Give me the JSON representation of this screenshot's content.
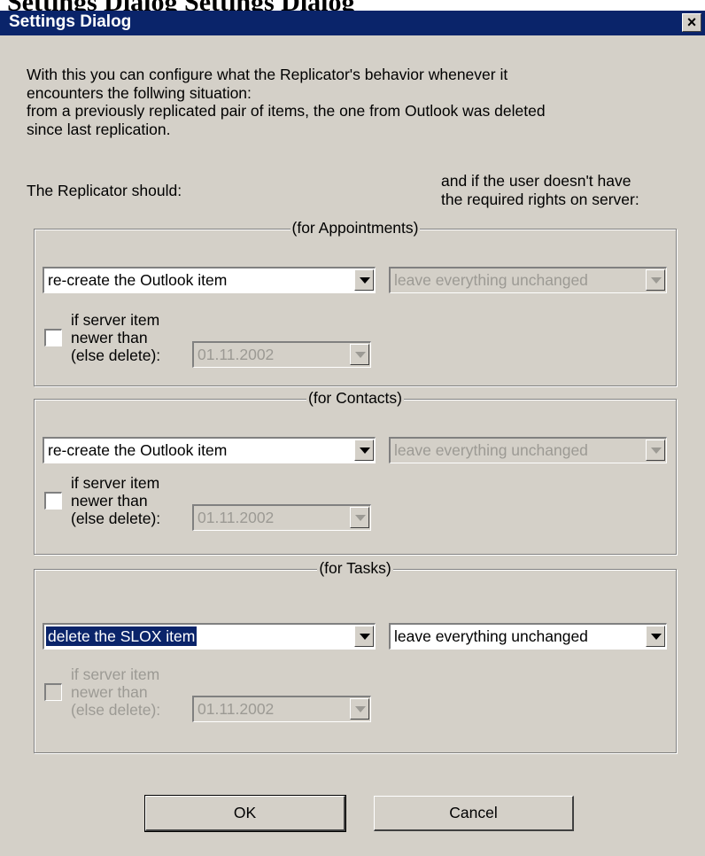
{
  "outer_title": "Settings Dialog Settings Dialog",
  "window": {
    "title": "Settings Dialog",
    "close_symbol": "×"
  },
  "intro": [
    "With this you can configure what the Replicator's behavior whenever it",
    "encounters the follwing situation:",
    "from a previously replicated pair of items, the one from Outlook was deleted",
    "since last replication."
  ],
  "replicator_label": "The Replicator should:",
  "rights_label": [
    "and if the user doesn't have",
    "the required rights on server:"
  ],
  "groups": [
    {
      "title": "(for Appointments)",
      "action": "re-create the Outlook item",
      "rights": "leave everything unchanged",
      "check_label": [
        "if server item",
        "newer than",
        "(else delete):"
      ],
      "date": "01.11.2002"
    },
    {
      "title": "(for Contacts)",
      "action": "re-create the Outlook item",
      "rights": "leave everything unchanged",
      "check_label": [
        "if server item",
        "newer than",
        "(else delete):"
      ],
      "date": "01.11.2002"
    },
    {
      "title": "(for Tasks)",
      "action": "delete the SLOX item",
      "rights": "leave everything unchanged",
      "check_label": [
        "if server item",
        "newer than",
        "(else delete):"
      ],
      "date": "01.11.2002"
    }
  ],
  "buttons": {
    "ok": "OK",
    "cancel": "Cancel"
  }
}
